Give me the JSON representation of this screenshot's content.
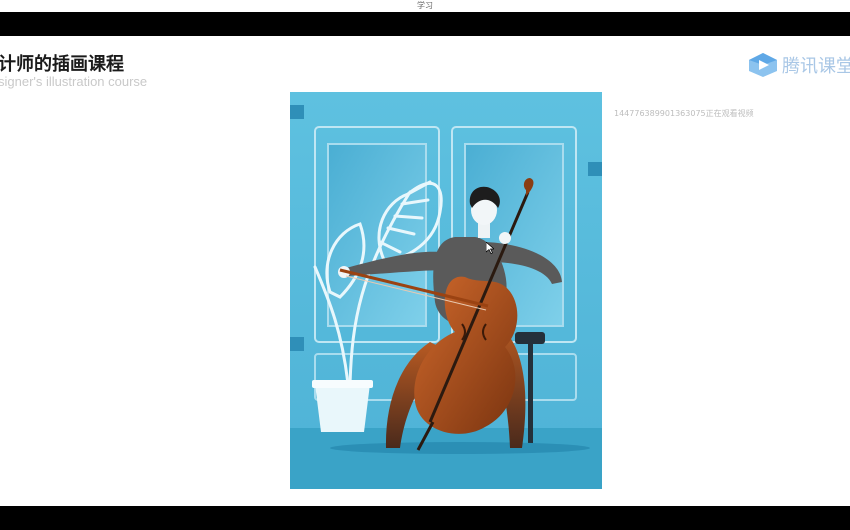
{
  "window": {
    "title": "学习"
  },
  "slide": {
    "title": "计师的插画课程",
    "subtitle": "signer's illustration course"
  },
  "brand": {
    "name": "腾讯课堂",
    "logo_icon": "play-triangle-icon",
    "logo_color": "#5fa8e6"
  },
  "watermark": {
    "text": "144776389901363075正在观看视频"
  },
  "illustration": {
    "subject": "cellist-playing-illustration",
    "colors": {
      "background": "#58b9d9",
      "floor": "#3aa3c7",
      "cello": "#b4531e",
      "sweater": "#585858"
    }
  }
}
